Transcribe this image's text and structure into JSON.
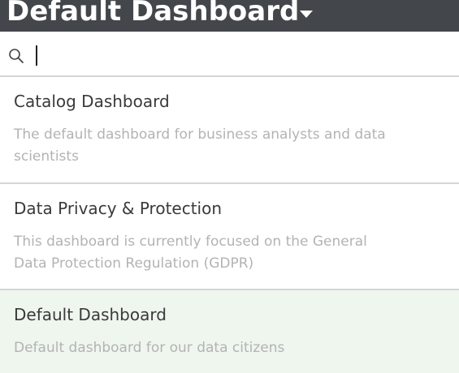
{
  "header": {
    "title": "Default Dashboard",
    "dropdown_icon": "caret-down-icon"
  },
  "search": {
    "icon": "search-icon",
    "value": "",
    "placeholder": ""
  },
  "dashboards": [
    {
      "title": "Catalog Dashboard",
      "description": "The default dashboard for business analysts and data scientists",
      "selected": false
    },
    {
      "title": "Data Privacy & Protection",
      "description": "This dashboard is currently focused on the General Data Protection Regulation (GDPR)",
      "selected": false
    },
    {
      "title": "Default Dashboard",
      "description": "Default dashboard for our data citizens",
      "selected": true
    }
  ],
  "colors": {
    "header_bg": "#43474b",
    "selected_bg": "#eef6ee",
    "title_text": "#3a3a3a",
    "description_text": "#b3b3b3",
    "divider": "#d6d6d6"
  }
}
